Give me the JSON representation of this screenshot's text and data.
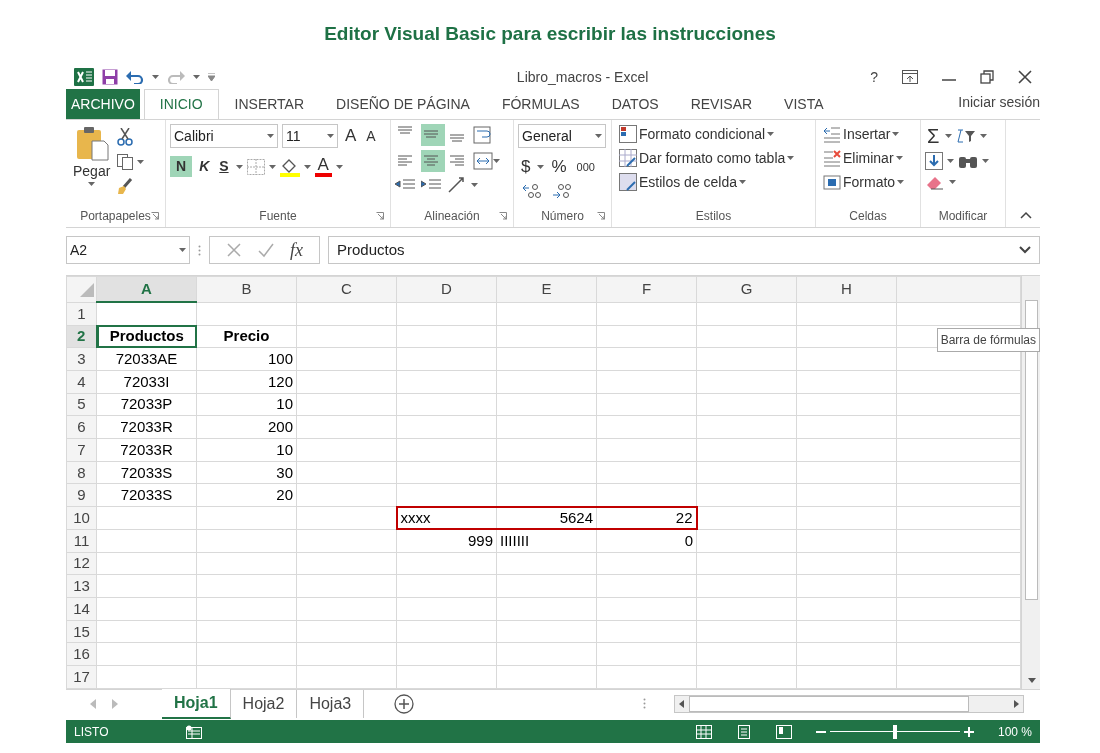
{
  "heading": "Editor Visual Basic para escribir las instrucciones",
  "window": {
    "title": "Libro_macros - Excel",
    "help": "?"
  },
  "tabs": [
    {
      "label": "ARCHIVO",
      "kind": "file",
      "selected": false
    },
    {
      "label": "INICIO",
      "kind": "tab",
      "selected": true
    },
    {
      "label": "INSERTAR",
      "kind": "tab",
      "selected": false
    },
    {
      "label": "DISEÑO DE PÁGINA",
      "kind": "tab",
      "selected": false
    },
    {
      "label": "FÓRMULAS",
      "kind": "tab",
      "selected": false
    },
    {
      "label": "DATOS",
      "kind": "tab",
      "selected": false
    },
    {
      "label": "REVISAR",
      "kind": "tab",
      "selected": false
    },
    {
      "label": "VISTA",
      "kind": "tab",
      "selected": false
    }
  ],
  "sign_in": "Iniciar sesión",
  "ribbon": {
    "clipboard": {
      "label": "Portapapeles",
      "paste": "Pegar"
    },
    "font": {
      "label": "Fuente",
      "font_name": "Calibri",
      "font_size": "11",
      "grow": "A",
      "shrink": "A",
      "bold": "N",
      "bold_on": true,
      "italic": "K",
      "underline": "S",
      "font_color": "A"
    },
    "alignment": {
      "label": "Alineación",
      "buttons": [
        {
          "kind": "top",
          "selected": false
        },
        {
          "kind": "middle",
          "selected": true
        },
        {
          "kind": "bottom",
          "selected": false
        },
        {
          "kind": "left",
          "selected": false
        },
        {
          "kind": "center",
          "selected": true
        },
        {
          "kind": "right",
          "selected": false
        }
      ]
    },
    "number": {
      "label": "Número",
      "format": "General",
      "currency": "$",
      "percent": "%",
      "thousands": "000"
    },
    "styles": {
      "label": "Estilos",
      "items": [
        "Formato condicional",
        "Dar formato como tabla",
        "Estilos de celda"
      ]
    },
    "cells": {
      "label": "Celdas",
      "items": [
        "Insertar",
        "Eliminar",
        "Formato"
      ]
    },
    "editing": {
      "label": "Modificar",
      "sum": "Σ"
    }
  },
  "formula_bar": {
    "name_box": "A2",
    "fx": "fx",
    "value": "Productos",
    "tooltip": "Barra de fórmulas"
  },
  "columns": [
    {
      "label": "A",
      "selected": true
    },
    {
      "label": "B",
      "selected": false
    },
    {
      "label": "C",
      "selected": false
    },
    {
      "label": "D",
      "selected": false
    },
    {
      "label": "E",
      "selected": false
    },
    {
      "label": "F",
      "selected": false
    },
    {
      "label": "G",
      "selected": false
    },
    {
      "label": "H",
      "selected": false
    }
  ],
  "rows": [
    {
      "header": "1",
      "selected": false,
      "cells": [
        null,
        null,
        null,
        null,
        null,
        null,
        null,
        null
      ]
    },
    {
      "header": "2",
      "selected": true,
      "cells": [
        {
          "text": "Productos",
          "kind": "center",
          "bold": true,
          "active": true
        },
        {
          "text": "Precio",
          "kind": "center",
          "bold": true
        },
        null,
        null,
        null,
        null,
        null,
        null
      ]
    },
    {
      "header": "3",
      "selected": false,
      "cells": [
        {
          "text": "72033AE",
          "kind": "center"
        },
        {
          "text": "100",
          "kind": "right"
        },
        null,
        null,
        null,
        null,
        null,
        null
      ]
    },
    {
      "header": "4",
      "selected": false,
      "cells": [
        {
          "text": "72033I",
          "kind": "center"
        },
        {
          "text": "120",
          "kind": "right"
        },
        null,
        null,
        null,
        null,
        null,
        null
      ]
    },
    {
      "header": "5",
      "selected": false,
      "cells": [
        {
          "text": "72033P",
          "kind": "center"
        },
        {
          "text": "10",
          "kind": "right"
        },
        null,
        null,
        null,
        null,
        null,
        null
      ]
    },
    {
      "header": "6",
      "selected": false,
      "cells": [
        {
          "text": "72033R",
          "kind": "center"
        },
        {
          "text": "200",
          "kind": "right"
        },
        null,
        null,
        null,
        null,
        null,
        null
      ]
    },
    {
      "header": "7",
      "selected": false,
      "cells": [
        {
          "text": "72033R",
          "kind": "center"
        },
        {
          "text": "10",
          "kind": "right"
        },
        null,
        null,
        null,
        null,
        null,
        null
      ]
    },
    {
      "header": "8",
      "selected": false,
      "cells": [
        {
          "text": "72033S",
          "kind": "center"
        },
        {
          "text": "30",
          "kind": "right"
        },
        null,
        null,
        null,
        null,
        null,
        null
      ]
    },
    {
      "header": "9",
      "selected": false,
      "cells": [
        {
          "text": "72033S",
          "kind": "center"
        },
        {
          "text": "20",
          "kind": "right"
        },
        null,
        null,
        null,
        null,
        null,
        null
      ]
    },
    {
      "header": "10",
      "selected": false,
      "cells": [
        null,
        null,
        null,
        {
          "text": "xxxx",
          "kind": "left",
          "outlined": true
        },
        {
          "text": "5624",
          "kind": "right",
          "outlined": true
        },
        {
          "text": "22",
          "kind": "right",
          "outlined": true
        },
        null,
        null
      ]
    },
    {
      "header": "11",
      "selected": false,
      "cells": [
        null,
        null,
        null,
        {
          "text": "999",
          "kind": "right"
        },
        {
          "text": "IIIIIII",
          "kind": "left"
        },
        {
          "text": "0",
          "kind": "right"
        },
        null,
        null
      ]
    },
    {
      "header": "12",
      "selected": false,
      "cells": [
        null,
        null,
        null,
        null,
        null,
        null,
        null,
        null
      ]
    },
    {
      "header": "13",
      "selected": false,
      "cells": [
        null,
        null,
        null,
        null,
        null,
        null,
        null,
        null
      ]
    },
    {
      "header": "14",
      "selected": false,
      "cells": [
        null,
        null,
        null,
        null,
        null,
        null,
        null,
        null
      ]
    },
    {
      "header": "15",
      "selected": false,
      "cells": [
        null,
        null,
        null,
        null,
        null,
        null,
        null,
        null
      ]
    },
    {
      "header": "16",
      "selected": false,
      "cells": [
        null,
        null,
        null,
        null,
        null,
        null,
        null,
        null
      ]
    },
    {
      "header": "17",
      "selected": false,
      "cells": [
        null,
        null,
        null,
        null,
        null,
        null,
        null,
        null
      ]
    }
  ],
  "sheet_tabs": [
    {
      "label": "Hoja1",
      "selected": true
    },
    {
      "label": "Hoja2",
      "selected": false
    },
    {
      "label": "Hoja3",
      "selected": false
    }
  ],
  "status_bar": {
    "state": "LISTO",
    "zoom": "100 %",
    "zoom_slider": {
      "level": 0.5
    }
  }
}
